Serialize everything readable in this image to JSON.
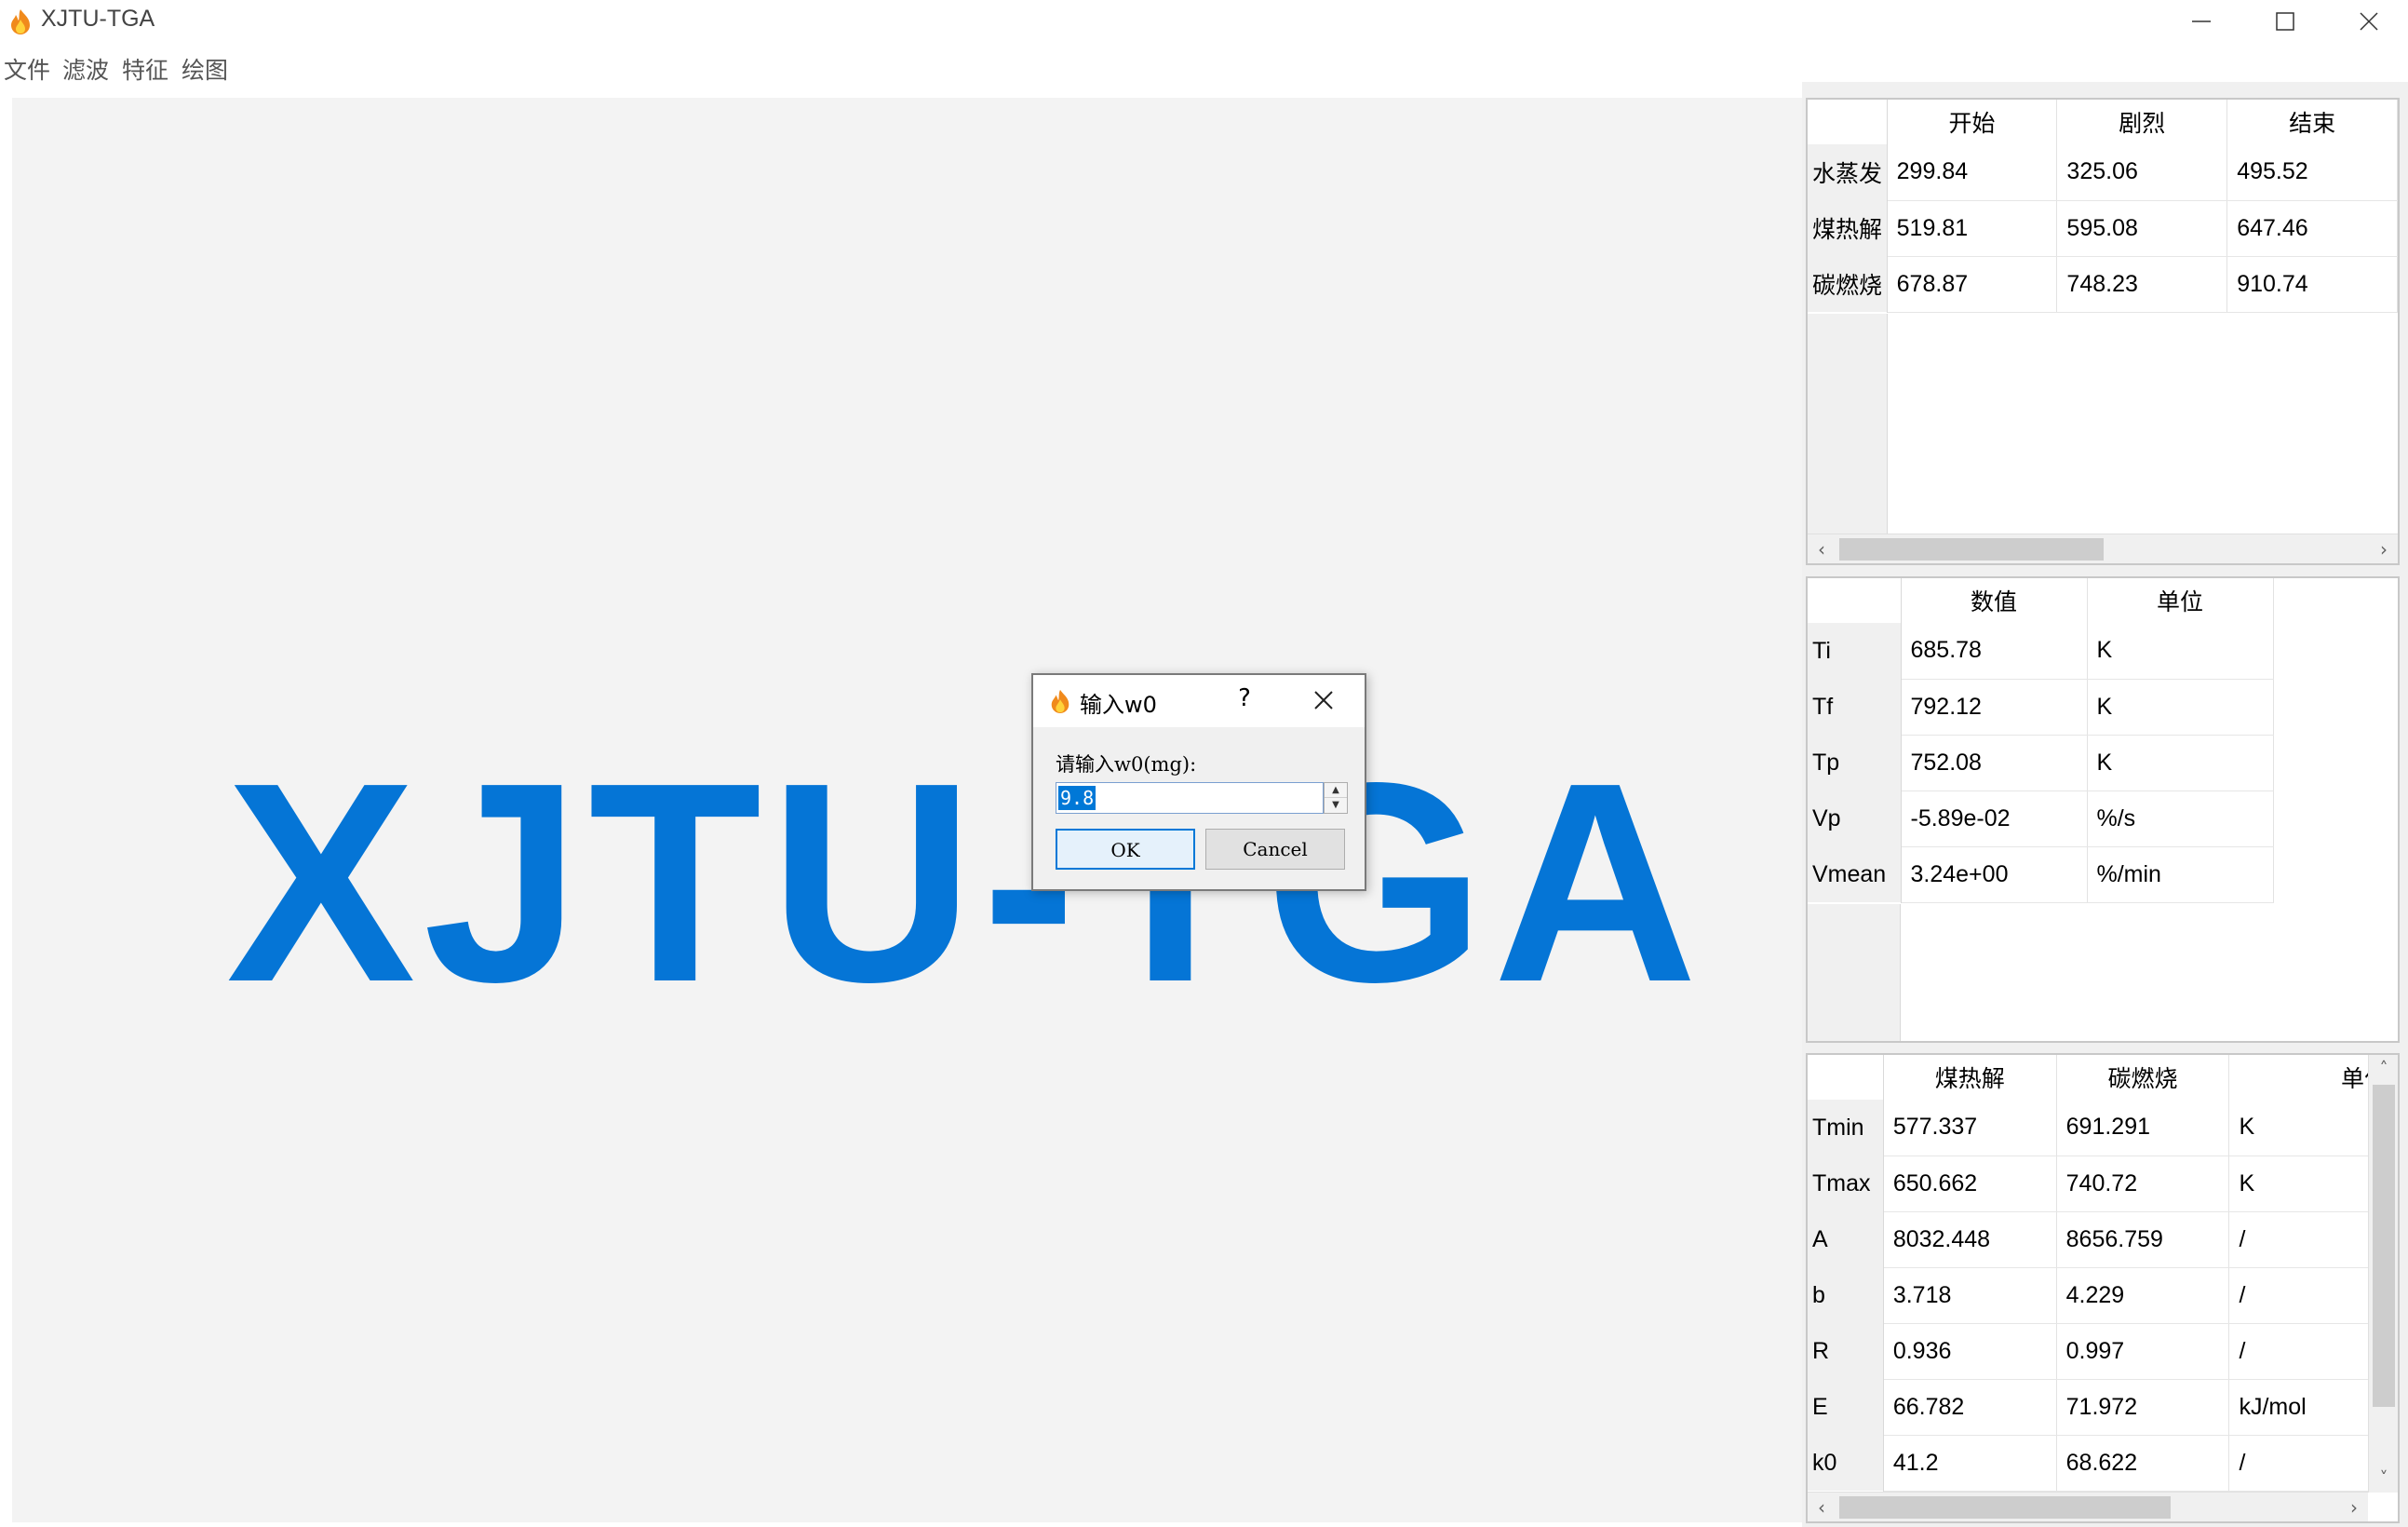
{
  "window": {
    "title": "XJTU-TGA"
  },
  "menu": {
    "items": [
      "文件",
      "滤波",
      "特征",
      "绘图"
    ]
  },
  "canvas": {
    "logo_text": "XJTU-TGA",
    "logo_color": "#0575d6"
  },
  "table1": {
    "columns": [
      "开始",
      "剧烈",
      "结束"
    ],
    "rows": [
      {
        "label": "水蒸发",
        "values": [
          "299.84",
          "325.06",
          "495.52"
        ]
      },
      {
        "label": "煤热解",
        "values": [
          "519.81",
          "595.08",
          "647.46"
        ]
      },
      {
        "label": "碳燃烧",
        "values": [
          "678.87",
          "748.23",
          "910.74"
        ]
      }
    ]
  },
  "table2": {
    "columns": [
      "数值",
      "单位"
    ],
    "rows": [
      {
        "label": "Ti",
        "values": [
          "685.78",
          "K"
        ]
      },
      {
        "label": "Tf",
        "values": [
          "792.12",
          "K"
        ]
      },
      {
        "label": "Tp",
        "values": [
          "752.08",
          "K"
        ]
      },
      {
        "label": "Vp",
        "values": [
          "-5.89e-02",
          "%/s"
        ]
      },
      {
        "label": "Vmean",
        "values": [
          "3.24e+00",
          "%/min"
        ]
      }
    ]
  },
  "table3": {
    "columns": [
      "煤热解",
      "碳燃烧",
      "单位"
    ],
    "rows": [
      {
        "label": "Tmin",
        "values": [
          "577.337",
          "691.291",
          "K"
        ]
      },
      {
        "label": "Tmax",
        "values": [
          "650.662",
          "740.72",
          "K"
        ]
      },
      {
        "label": "A",
        "values": [
          "8032.448",
          "8656.759",
          "/"
        ]
      },
      {
        "label": "b",
        "values": [
          "3.718",
          "4.229",
          "/"
        ]
      },
      {
        "label": "R",
        "values": [
          "0.936",
          "0.997",
          "/"
        ]
      },
      {
        "label": "E",
        "values": [
          "66.782",
          "71.972",
          "kJ/mol"
        ]
      },
      {
        "label": "k0",
        "values": [
          "41.2",
          "68.622",
          "/"
        ]
      }
    ]
  },
  "dialog": {
    "title": "输入w0",
    "help": "?",
    "prompt": "请输入w0(mg):",
    "value": "9.8",
    "ok_label": "OK",
    "cancel_label": "Cancel",
    "accent_color": "#0078d7"
  },
  "icons": [
    "flame-icon",
    "minimize-icon",
    "maximize-icon",
    "close-icon",
    "scroll-left-icon",
    "scroll-right-icon",
    "scroll-up-icon",
    "scroll-down-icon",
    "spin-up-icon",
    "spin-down-icon"
  ]
}
